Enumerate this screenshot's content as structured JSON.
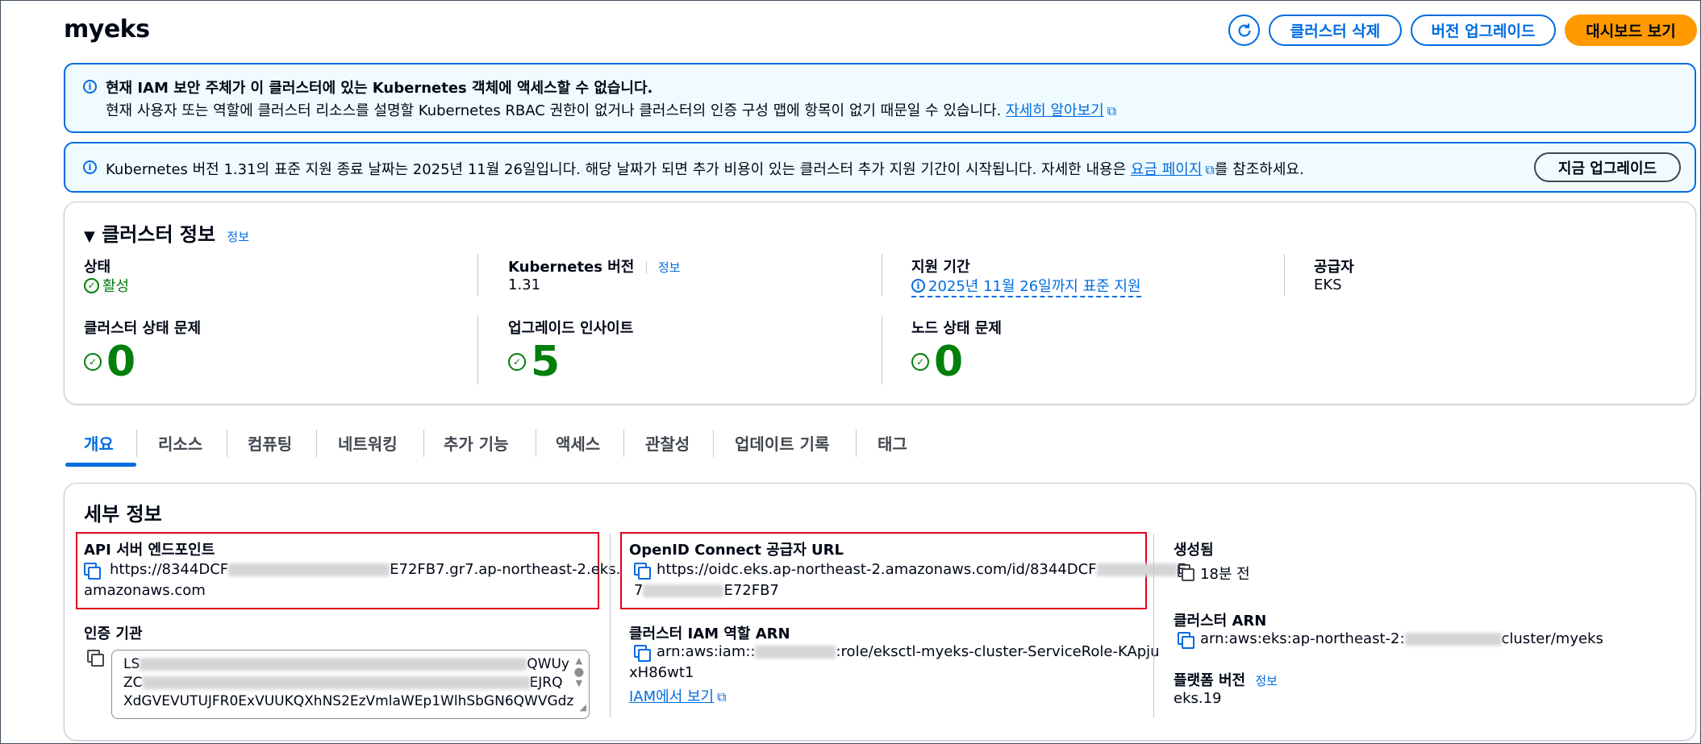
{
  "header": {
    "title": "myeks",
    "buttons": {
      "delete": "클러스터 삭제",
      "upgrade_version": "버전 업그레이드",
      "dashboard": "대시보드 보기"
    },
    "icons": {
      "refresh": "refresh-icon"
    }
  },
  "alerts": {
    "iam": {
      "title": "현재 IAM 보안 주체가 이 클러스터에 있는 Kubernetes 객체에 액세스할 수 없습니다.",
      "body": "현재 사용자 또는 역할에 클러스터 리소스를 설명할 Kubernetes RBAC 권한이 없거나 클러스터의 인증 구성 맵에 항목이 없기 때문일 수 있습니다.",
      "link": "자세히 알아보기"
    },
    "version": {
      "text": "Kubernetes 버전 1.31의 표준 지원 종료 날짜는 2025년 11월 26일입니다. 해당 날짜가 되면 추가 비용이 있는 클러스터 추가 지원 기간이 시작됩니다. 자세한 내용은",
      "link": "요금 페이지",
      "suffix": "를 참조하세요.",
      "button": "지금 업그레이드"
    }
  },
  "cluster_info": {
    "title": "클러스터 정보",
    "info": "정보",
    "status_label": "상태",
    "status_value": "활성",
    "version_label": "Kubernetes 버전",
    "version_info": "정보",
    "version_value": "1.31",
    "support_label": "지원 기간",
    "support_value": "2025년 11월 26일까지 표준 지원",
    "provider_label": "공급자",
    "provider_value": "EKS",
    "health_label": "클러스터 상태 문제",
    "health_value": "0",
    "insights_label": "업그레이드 인사이트",
    "insights_value": "5",
    "node_label": "노드 상태 문제",
    "node_value": "0"
  },
  "tabs": [
    "개요",
    "리소스",
    "컴퓨팅",
    "네트워킹",
    "추가 기능",
    "액세스",
    "관찰성",
    "업데이트 기록",
    "태그"
  ],
  "details": {
    "title": "세부 정보",
    "api_label": "API 서버 엔드포인트",
    "api_value_start": "https://8344DCF",
    "api_value_end": "E72FB7.gr7.ap-northeast-2.eks.",
    "api_value_line2": "amazonaws.com",
    "cert_label": "인증 기관",
    "cert_line1_start": "LS",
    "cert_line1_end": "QWUy",
    "cert_line2_start": "ZC",
    "cert_line2_end": "EJRQ",
    "cert_line3": "XdGVEVUTUJFR0ExVUUKQXhNS2EzVmlaWEp1WlhSbGN6QWVGdz",
    "oidc_label": "OpenID Connect 공급자 URL",
    "oidc_value_start": "https://oidc.eks.ap-northeast-2.amazonaws.com/id/8344DCF",
    "oidc_value_end": "E",
    "oidc_line2_start": "7",
    "oidc_line2_end": "E72FB7",
    "role_label": "클러스터 IAM 역할 ARN",
    "role_value_start": "arn:aws:iam::",
    "role_value_end": ":role/eksctl-myeks-cluster-ServiceRole-KApju",
    "role_line2": "xH86wt1",
    "iam_link": "IAM에서 보기",
    "created_label": "생성됨",
    "created_value": "18분 전",
    "arn_label": "클러스터 ARN",
    "arn_value_start": "arn:aws:eks:ap-northeast-2:",
    "arn_value_end": "cluster/myeks",
    "platform_label": "플랫폼 버전",
    "platform_info": "정보",
    "platform_value": "eks.19"
  },
  "colors": {
    "accent": "#006ce0",
    "primary": "#ff9900",
    "success": "#037f0c",
    "highlight": "#e0001f"
  }
}
